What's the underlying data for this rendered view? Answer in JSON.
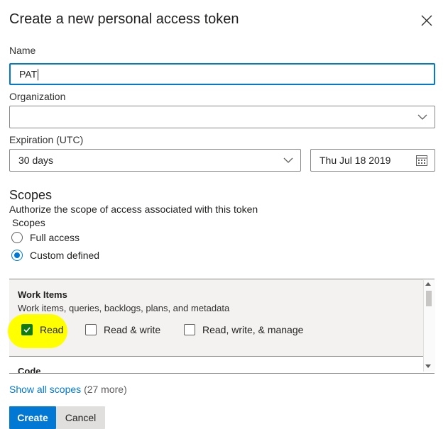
{
  "dialog": {
    "title": "Create a new personal access token"
  },
  "name": {
    "label": "Name",
    "value": "PAT"
  },
  "organization": {
    "label": "Organization",
    "value": ""
  },
  "expiration": {
    "label": "Expiration (UTC)",
    "selected": "30 days",
    "date": "Thu Jul 18 2019"
  },
  "scopes": {
    "heading": "Scopes",
    "description": "Authorize the scope of access associated with this token",
    "sublabel": "Scopes",
    "options": [
      {
        "label": "Full access",
        "selected": false
      },
      {
        "label": "Custom defined",
        "selected": true
      }
    ],
    "work_items": {
      "title": "Work Items",
      "description": "Work items, queries, backlogs, plans, and metadata",
      "options": [
        {
          "label": "Read",
          "checked": true
        },
        {
          "label": "Read & write",
          "checked": false
        },
        {
          "label": "Read, write, & manage",
          "checked": false
        }
      ]
    },
    "next_section": "Code",
    "show_all_link": "Show all scopes",
    "more_count": "(27 more)"
  },
  "buttons": {
    "create": "Create",
    "cancel": "Cancel"
  },
  "colors": {
    "accent": "#0078d4",
    "check": "#107c10",
    "highlight": "#ffff00"
  }
}
